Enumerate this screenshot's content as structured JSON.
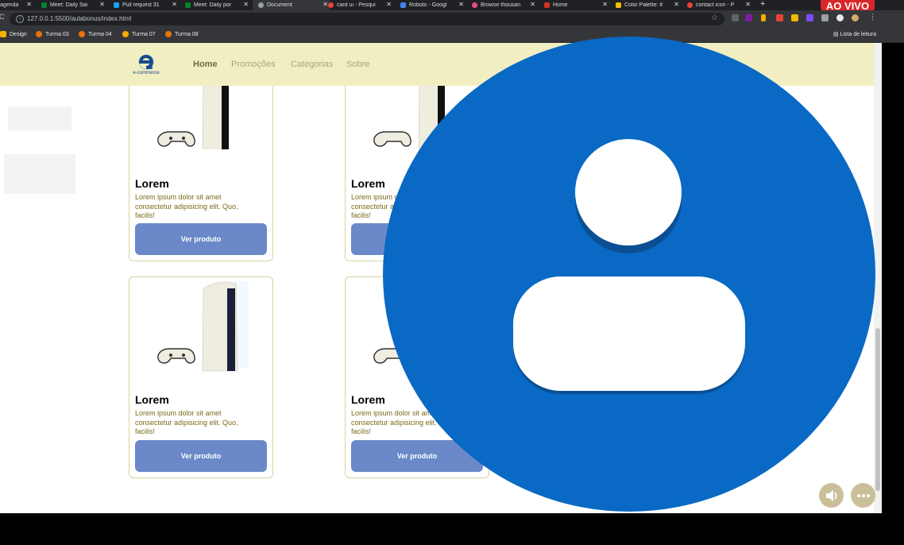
{
  "browser": {
    "tabs": [
      {
        "title": "agenda",
        "color": "#4285f4"
      },
      {
        "title": "Meet: Daily Sai",
        "color": "#00832d"
      },
      {
        "title": "Pull request 31",
        "color": "#1da1f2"
      },
      {
        "title": "Meet: Daily por",
        "color": "#00832d"
      },
      {
        "title": "Document",
        "color": "#9aa0a6"
      },
      {
        "title": "card ui - Pesqui",
        "color": "#ea4335"
      },
      {
        "title": "Roboto - Googl",
        "color": "#4285f4"
      },
      {
        "title": "Browse thousan",
        "color": "#ea4c89"
      },
      {
        "title": "Home",
        "color": "#d93025"
      },
      {
        "title": "Color Palette: #",
        "color": "#fbbc04"
      },
      {
        "title": "contact icon - P",
        "color": "#ea4335"
      }
    ],
    "new_tab": "+",
    "live_badge": "AO VIVO",
    "url": "127.0.0.1:5500/aulabonus/index.html",
    "bookmarks": [
      {
        "label": "Design",
        "color": "#f4b400"
      },
      {
        "label": "Turma 03",
        "color": "#e8710a"
      },
      {
        "label": "Turma 04",
        "color": "#e8710a"
      },
      {
        "label": "Turma 07",
        "color": "#f9ab00"
      },
      {
        "label": "Turma 08",
        "color": "#e8710a"
      }
    ],
    "reading_list": "Lista de leitura"
  },
  "site": {
    "logo_text": "e-commerce",
    "nav": [
      "Home",
      "Promoções",
      "Categorias",
      "Sobre"
    ]
  },
  "products": [
    {
      "title": "Lorem",
      "description": "Lorem ipsum dolor sit amet consectetur adipisicing elit. Quo, facilis!",
      "button": "Ver produto"
    },
    {
      "title": "Lorem",
      "description": "Lorem ipsum dolor sit amet consectetur adipisicing elit. Quo, facilis!",
      "button": "Ver produto"
    },
    {
      "title": "Lorem",
      "description": "Lorem ipsum dolor sit amet consectetur adipisicing elit. Quo, facilis!",
      "button": "Ver produto"
    },
    {
      "title": "Lorem",
      "description": "Lorem ipsum dolor sit amet consectetur adipisicing elit. Quo, facilis!",
      "button": "Ver produto"
    }
  ],
  "overlay": {
    "icon": "person-avatar-icon",
    "circle_color": "#0969c4",
    "controls": [
      "volume-icon",
      "more-options-icon"
    ]
  }
}
